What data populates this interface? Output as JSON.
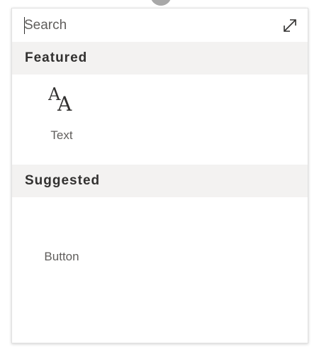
{
  "search": {
    "placeholder": "Search",
    "value": ""
  },
  "icons": {
    "expand": "expand-icon",
    "text": "text-icon"
  },
  "sections": {
    "featured": {
      "title": "Featured",
      "items": [
        {
          "label": "Text",
          "icon": "text-icon"
        }
      ]
    },
    "suggested": {
      "title": "Suggested",
      "items": [
        {
          "label": "Button"
        }
      ]
    }
  },
  "colors": {
    "header_background": "#f3f2f1",
    "text_primary": "#323130",
    "text_secondary": "#605e5c",
    "panel_border": "#e1e1e1"
  }
}
